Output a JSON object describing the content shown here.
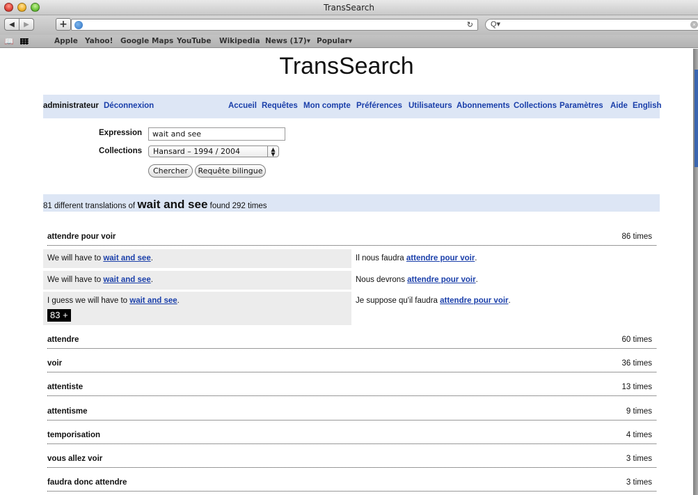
{
  "window": {
    "title": "TransSearch"
  },
  "toolbar": {
    "url": "",
    "search_placeholder": "",
    "back_icon": "back-arrow-icon",
    "forward_icon": "forward-arrow-icon",
    "add_icon": "plus-icon",
    "reload_icon": "reload-icon"
  },
  "bookmarks": {
    "items": [
      "Apple",
      "Yahoo!",
      "Google Maps",
      "YouTube",
      "Wikipedia",
      "News (17)▾",
      "Popular▾"
    ]
  },
  "page": {
    "title": "TransSearch"
  },
  "nav": {
    "user": "administrateur",
    "logout": "Déconnexion",
    "links": [
      "Accueil",
      "Requêtes",
      "Mon compte",
      "Préférences",
      "Utilisateurs",
      "Abonnements",
      "Collections",
      "Paramètres",
      "Aide",
      "English"
    ]
  },
  "form": {
    "expression_label": "Expression",
    "expression_value": "wait and see",
    "collections_label": "Collections",
    "collections_value": "Hansard – 1994 / 2004",
    "search_button": "Chercher",
    "bilingual_button": "Requête bilingue"
  },
  "results": {
    "prefix": "81 different translations of",
    "query": "wait and see",
    "suffix": "found 292 times"
  },
  "translations": [
    {
      "term": "attendre pour voir",
      "count": "86 times"
    },
    {
      "term": "attendre",
      "count": "60 times"
    },
    {
      "term": "voir",
      "count": "36 times"
    },
    {
      "term": "attentiste",
      "count": "13 times"
    },
    {
      "term": "attentisme",
      "count": "9 times"
    },
    {
      "term": "temporisation",
      "count": "4 times"
    },
    {
      "term": "vous allez voir",
      "count": "3 times"
    },
    {
      "term": "faudra donc attendre",
      "count": "3 times"
    }
  ],
  "examples": [
    {
      "en_before": "We will have to ",
      "en_hl": "wait and see",
      "en_after": ".",
      "fr_before": "Il nous faudra ",
      "fr_hl": "attendre pour voir",
      "fr_after": "."
    },
    {
      "en_before": "We will have to ",
      "en_hl": "wait and see",
      "en_after": ".",
      "fr_before": "Nous devrons ",
      "fr_hl": "attendre pour voir",
      "fr_after": "."
    },
    {
      "en_before": "I guess we will have to ",
      "en_hl": "wait and see",
      "en_after": ".",
      "fr_before": "Je suppose qu'il faudra ",
      "fr_hl": "attendre pour voir",
      "fr_after": "."
    }
  ],
  "more_badge": "83 +"
}
